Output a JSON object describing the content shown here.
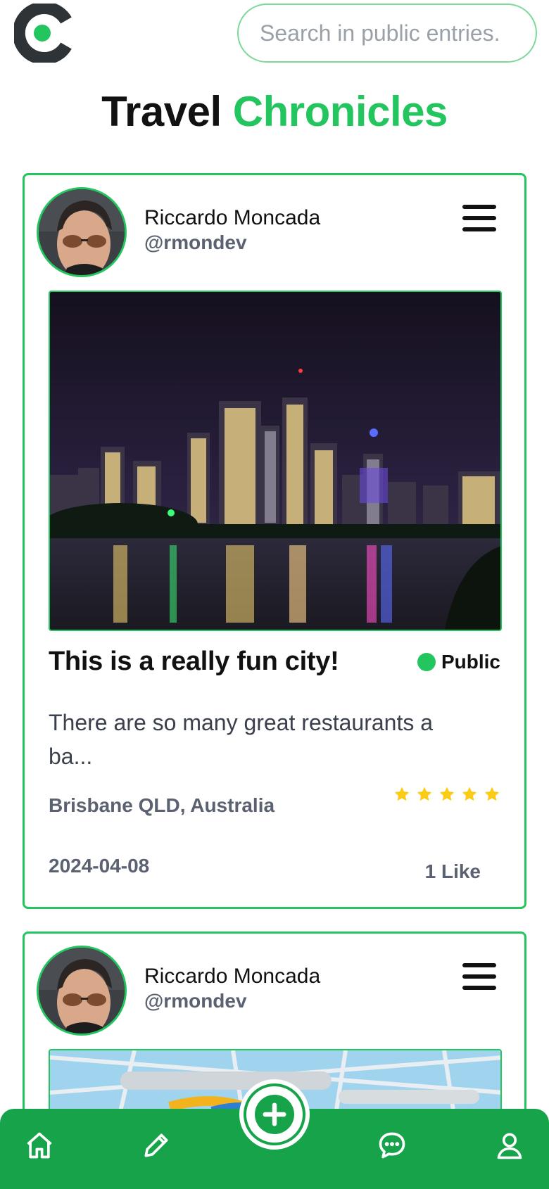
{
  "header": {
    "search_placeholder": "Search in public entries.",
    "title_part1": "Travel",
    "title_part2": "Chronicles"
  },
  "colors": {
    "accent": "#22c55e",
    "nav_bg": "#16a34a",
    "star": "#facc15",
    "muted": "#5a6170"
  },
  "entries": [
    {
      "user_name": "Riccardo Moncada",
      "user_handle": "@rmondev",
      "title": "This is a really fun city!",
      "visibility": "Public",
      "excerpt": "There are so many great restaurants a ba...",
      "location": "Brisbane QLD, Australia",
      "rating": 5,
      "date": "2024-04-08",
      "likes": "1 Like"
    },
    {
      "user_name": "Riccardo Moncada",
      "user_handle": "@rmondev"
    }
  ],
  "nav": {
    "items": [
      "home-icon",
      "pencil-icon",
      "plus-icon",
      "chat-icon",
      "user-icon"
    ]
  }
}
